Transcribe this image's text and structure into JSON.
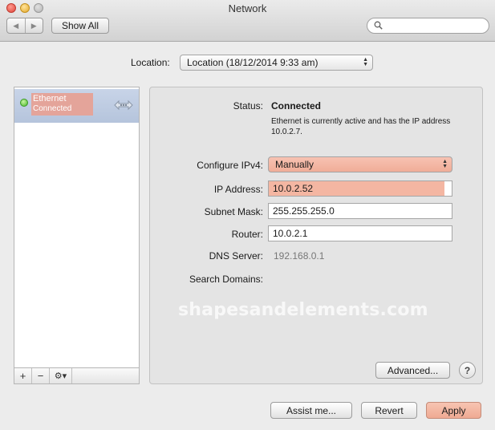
{
  "window": {
    "title": "Network"
  },
  "toolbar": {
    "back_glyph": "◀",
    "forward_glyph": "▶",
    "show_all_label": "Show All",
    "search_placeholder": "",
    "search_icon": "search-icon"
  },
  "location": {
    "label": "Location:",
    "value": "Location (18/12/2014 9:33 am)"
  },
  "sidebar": {
    "items": [
      {
        "name": "Ethernet",
        "status": "Connected",
        "status_color": "#46b52a",
        "icon": "ethernet-icon"
      }
    ],
    "add_label": "+",
    "remove_label": "−",
    "action_label": "⚙▾"
  },
  "details": {
    "status_label": "Status:",
    "status_value": "Connected",
    "status_description": "Ethernet is currently active and has the IP address 10.0.2.7.",
    "configure_label": "Configure IPv4:",
    "configure_value": "Manually",
    "ip_label": "IP Address:",
    "ip_value": "10.0.2.52",
    "subnet_label": "Subnet Mask:",
    "subnet_value": "255.255.255.0",
    "router_label": "Router:",
    "router_value": "10.0.2.1",
    "dns_label": "DNS Server:",
    "dns_value": "192.168.0.1",
    "search_domains_label": "Search Domains:",
    "watermark": "shapesandelements.com",
    "advanced_label": "Advanced...",
    "help_label": "?"
  },
  "footer": {
    "assist_label": "Assist me...",
    "revert_label": "Revert",
    "apply_label": "Apply"
  },
  "colors": {
    "highlight": "#f4b6a2",
    "selection": "#c8d4e8"
  }
}
